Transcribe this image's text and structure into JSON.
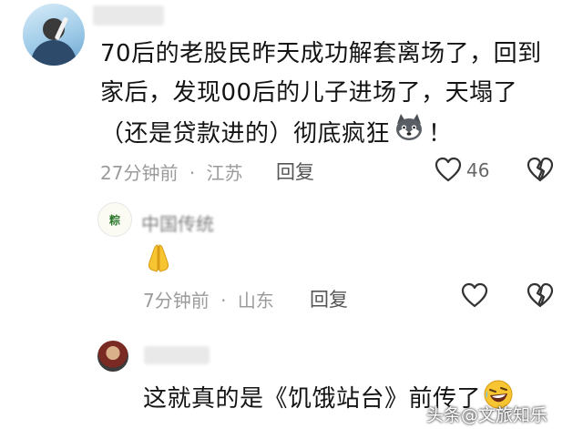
{
  "comments": [
    {
      "text_lines": [
        "70后的老股民昨天成功解套离场了，回到",
        "家后，发现00后的儿子进场了，天塌了",
        "（还是贷款进的）彻底疯狂"
      ],
      "text_tail": "！",
      "inline_emoji": "husky-dog-emoji",
      "time": "27分钟前",
      "location": "江苏",
      "reply_label": "回复",
      "like_count": "46"
    },
    {
      "username_partial": "中国传统",
      "avatar_label": "粽",
      "content_emoji": "folded-hands-emoji",
      "time": "7分钟前",
      "location": "山东",
      "reply_label": "回复"
    },
    {
      "text": "这就真的是《饥饿站台》前传了",
      "inline_emoji": "rolling-laughing-emoji"
    }
  ],
  "separator": "·",
  "watermark": "头条@文旅知乐",
  "colors": {
    "meta_gray": "#9b9b9b",
    "icon_gray": "#333333",
    "emoji_yellow": "#f7c531"
  }
}
